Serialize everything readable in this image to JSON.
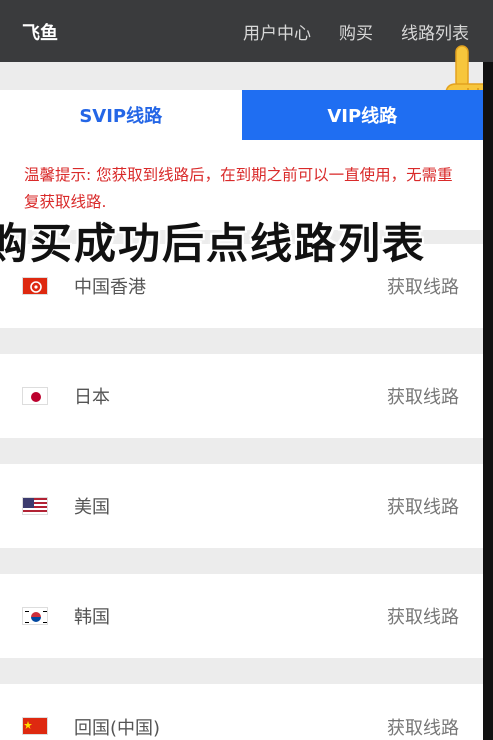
{
  "header": {
    "brand": "飞鱼",
    "nav": [
      "用户中心",
      "购买",
      "线路列表"
    ]
  },
  "tabs": [
    {
      "label": "SVIP线路",
      "active": false
    },
    {
      "label": "VIP线路",
      "active": true
    }
  ],
  "notice": {
    "text": "温馨提示: 您获取到线路后，在到期之前可以一直使用，无需重复获取线路."
  },
  "overlay_text": "购买成功后点线路列表",
  "servers": [
    {
      "country": "中国香港",
      "flag": "hk-flag-icon",
      "action": "获取线路"
    },
    {
      "country": "日本",
      "flag": "jp-flag-icon",
      "action": "获取线路"
    },
    {
      "country": "美国",
      "flag": "us-flag-icon",
      "action": "获取线路"
    },
    {
      "country": "韩国",
      "flag": "kr-flag-icon",
      "action": "获取线路"
    },
    {
      "country": "回国(中国)",
      "flag": "cn-flag-icon",
      "action": "获取线路"
    }
  ],
  "colors": {
    "header_bg": "#3a3b3d",
    "accent": "#1f6ef2",
    "notice_text": "#d92a2a"
  }
}
